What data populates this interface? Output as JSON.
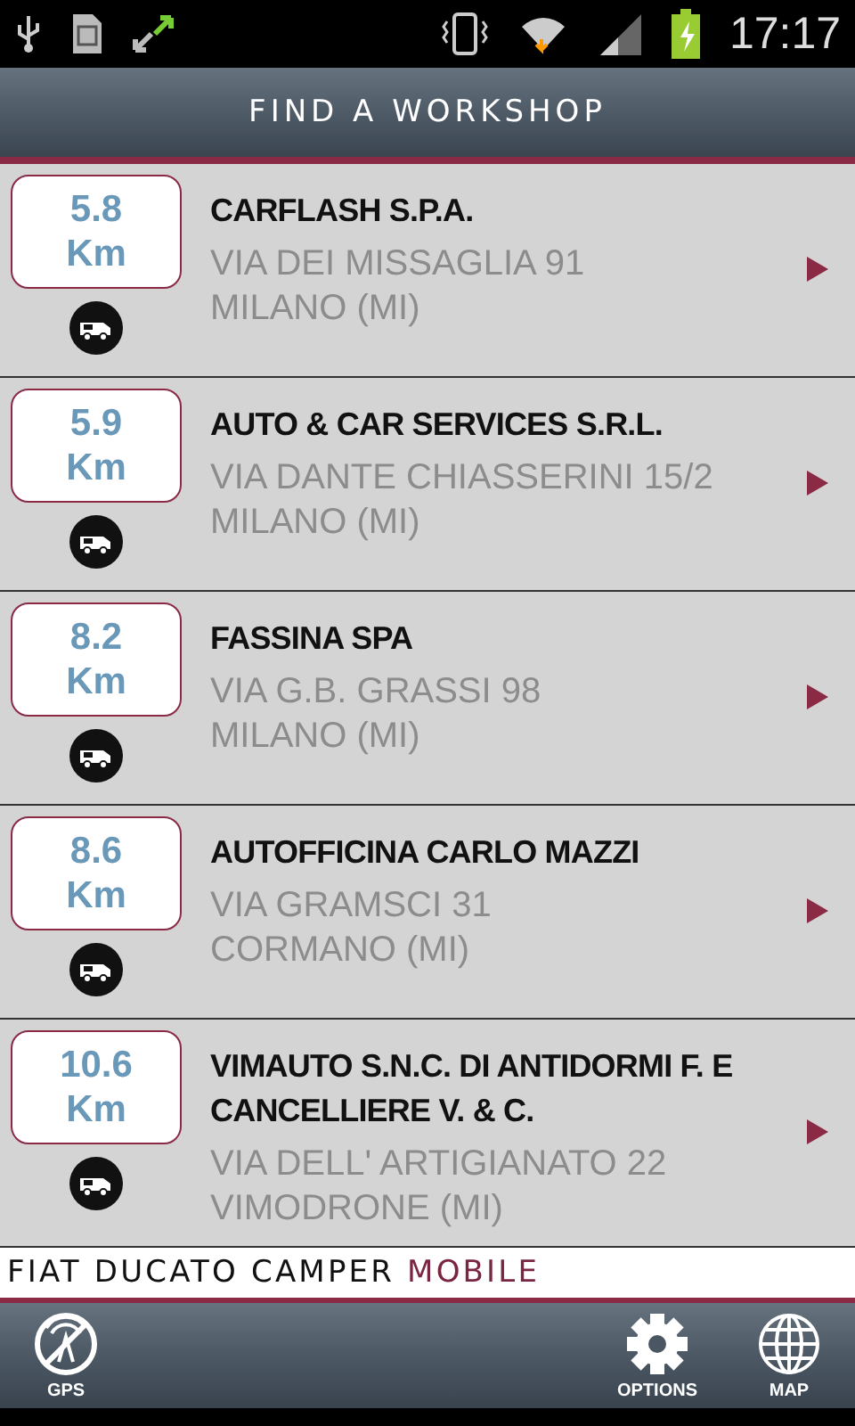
{
  "status_bar": {
    "time": "17:17"
  },
  "header": {
    "title": "FIND A WORKSHOP"
  },
  "workshops": [
    {
      "distance": "5.8",
      "unit": "Km",
      "name": "CARFLASH S.P.A.",
      "street": "VIA DEI MISSAGLIA 91",
      "city": "MILANO (MI)"
    },
    {
      "distance": "5.9",
      "unit": "Km",
      "name": "AUTO & CAR SERVICES S.R.L.",
      "street": "VIA DANTE CHIASSERINI 15/2",
      "city": "MILANO (MI)"
    },
    {
      "distance": "8.2",
      "unit": "Km",
      "name": "FASSINA SPA",
      "street": "VIA G.B. GRASSI 98",
      "city": "MILANO (MI)"
    },
    {
      "distance": "8.6",
      "unit": "Km",
      "name": "AUTOFFICINA CARLO MAZZI",
      "street": "VIA GRAMSCI 31",
      "city": "CORMANO (MI)"
    },
    {
      "distance": "10.6",
      "unit": "Km",
      "name": "VIMAUTO S.N.C. DI ANTIDORMI F. E CANCELLIERE V. & C.",
      "street": "VIA DELL' ARTIGIANATO 22",
      "city": "VIMODRONE (MI)"
    }
  ],
  "brand": {
    "name": "FIAT DUCATO CAMPER",
    "suffix": "MOBILE"
  },
  "toolbar": [
    {
      "kind": "gps",
      "label": "GPS"
    },
    {
      "kind": "options",
      "label": "OPTIONS"
    },
    {
      "kind": "map",
      "label": "MAP"
    }
  ]
}
